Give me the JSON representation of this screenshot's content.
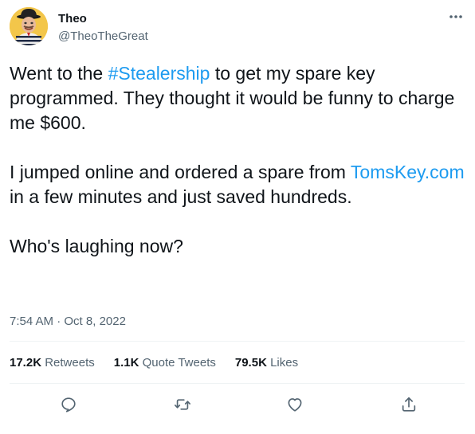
{
  "author": {
    "display_name": "Theo",
    "handle": "@TheoTheGreat"
  },
  "tweet": {
    "para1": {
      "before_hashtag": "Went to the ",
      "hashtag": "#Stealership",
      "after_hashtag": " to get my spare key programmed. They thought it would be funny to charge me $600."
    },
    "para2": {
      "before_link": "I jumped online and ordered a spare from ",
      "link": "TomsKey.com",
      "after_link": " in a few minutes and just saved hundreds."
    },
    "para3": "Who's laughing now?",
    "time": "7:54 AM",
    "separator": " · ",
    "date": "Oct 8, 2022"
  },
  "stats": {
    "retweets": {
      "count": "17.2K",
      "label": "Retweets"
    },
    "quote_tweets": {
      "count": "1.1K",
      "label": "Quote Tweets"
    },
    "likes": {
      "count": "79.5K",
      "label": "Likes"
    }
  },
  "icons": {
    "more": "more-horizontal-icon",
    "reply": "reply-icon",
    "retweet": "retweet-icon",
    "like": "heart-icon",
    "share": "share-icon"
  },
  "colors": {
    "link": "#1d9bf0",
    "text": "#0f1419",
    "secondary": "#536471",
    "divider": "#eff3f4"
  }
}
